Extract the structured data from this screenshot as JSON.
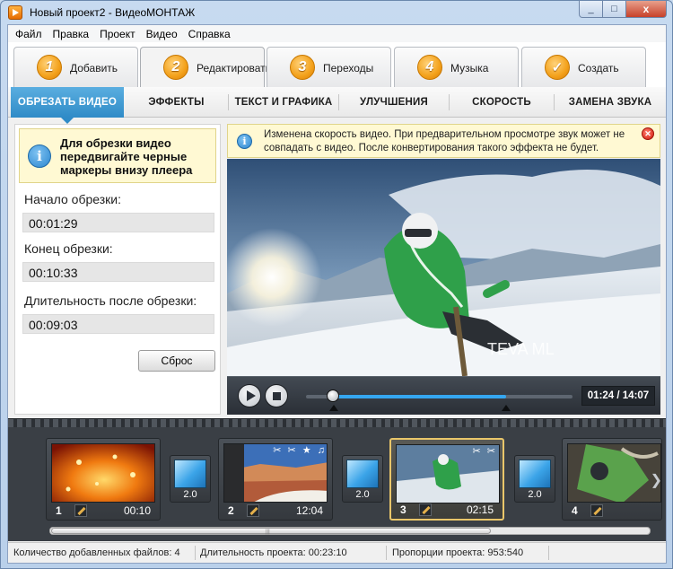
{
  "window": {
    "title": "Новый проект2 - ВидеоМОНТАЖ",
    "close_glyph": "x",
    "min_glyph": "_",
    "max_glyph": "□"
  },
  "menu": [
    "Файл",
    "Правка",
    "Проект",
    "Видео",
    "Справка"
  ],
  "steps": [
    {
      "num": "1",
      "label": "Добавить"
    },
    {
      "num": "2",
      "label": "Редактировать"
    },
    {
      "num": "3",
      "label": "Переходы"
    },
    {
      "num": "4",
      "label": "Музыка"
    },
    {
      "num": "✓",
      "label": "Создать"
    }
  ],
  "subtabs": [
    "ОБРЕЗАТЬ ВИДЕО",
    "ЭФФЕКТЫ",
    "ТЕКСТ И ГРАФИКА",
    "УЛУЧШЕНИЯ",
    "СКОРОСТЬ",
    "ЗАМЕНА ЗВУКА"
  ],
  "trim": {
    "tip": "Для обрезки видео передвигайте черные маркеры внизу плеера",
    "start_label": "Начало обрезки:",
    "start_value": "00:01:29",
    "end_label": "Конец обрезки:",
    "end_value": "00:10:33",
    "duration_label": "Длительность после обрезки:",
    "duration_value": "00:09:03",
    "reset": "Сброс"
  },
  "info": {
    "text": "Изменена скорость видео. При предварительном просмотре звук может не совпадать с видео. После конвертирования такого эффекта не будет."
  },
  "player": {
    "watermark": "TEVA ML",
    "time": "01:24 / 14:07",
    "progress": 0.1,
    "trim_start": 0.105,
    "trim_end": 0.75
  },
  "clips": [
    {
      "num": "1",
      "duration": "00:10",
      "fx": ""
    },
    {
      "num": "2",
      "duration": "12:04",
      "fx": "✂ ✂ ★ ♫"
    },
    {
      "num": "3",
      "duration": "02:15",
      "fx": "✂ ✂"
    },
    {
      "num": "4",
      "duration": "",
      "fx": ""
    }
  ],
  "transitions": [
    "2.0",
    "2.0",
    "2.0"
  ],
  "status": {
    "files": "Количество добавленных файлов: 4",
    "duration": "Длительность проекта:  00:23:10",
    "ratio": "Пропорции проекта:  953:540"
  },
  "colors": {
    "accent": "#3a97d4",
    "step_badge": "#f3a11b",
    "tip_bg": "#fff9d3"
  }
}
